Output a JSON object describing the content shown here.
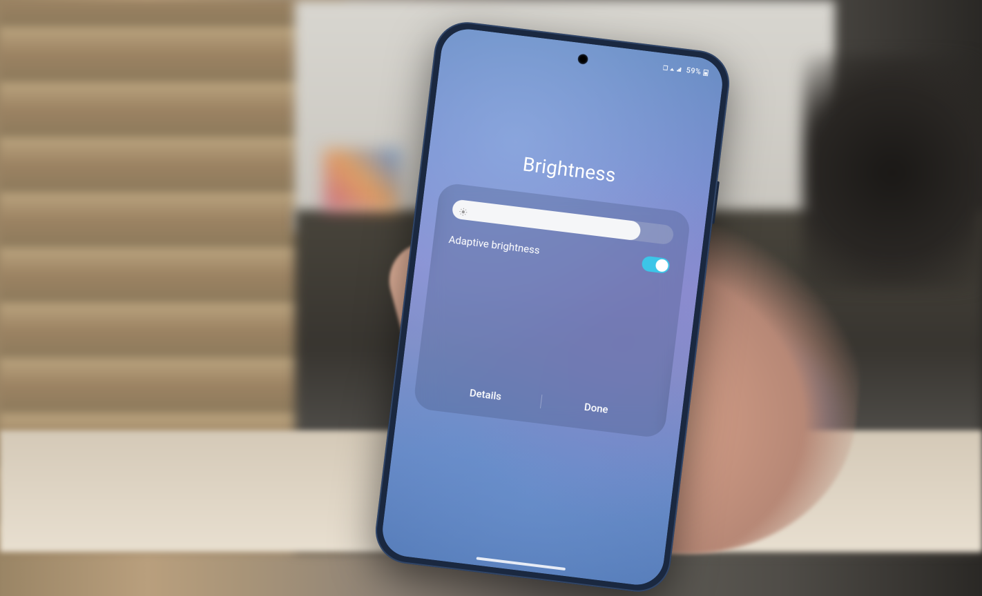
{
  "status_bar": {
    "battery_text": "59%",
    "indicators": "⬚ ⫽ ⏺"
  },
  "page": {
    "title": "Brightness"
  },
  "brightness": {
    "slider_percent": 85,
    "adaptive_label": "Adaptive brightness",
    "adaptive_on": true
  },
  "actions": {
    "details": "Details",
    "done": "Done"
  },
  "colors": {
    "toggle_on": "#3cc5e8",
    "slider_fill": "#f5f6f8"
  }
}
